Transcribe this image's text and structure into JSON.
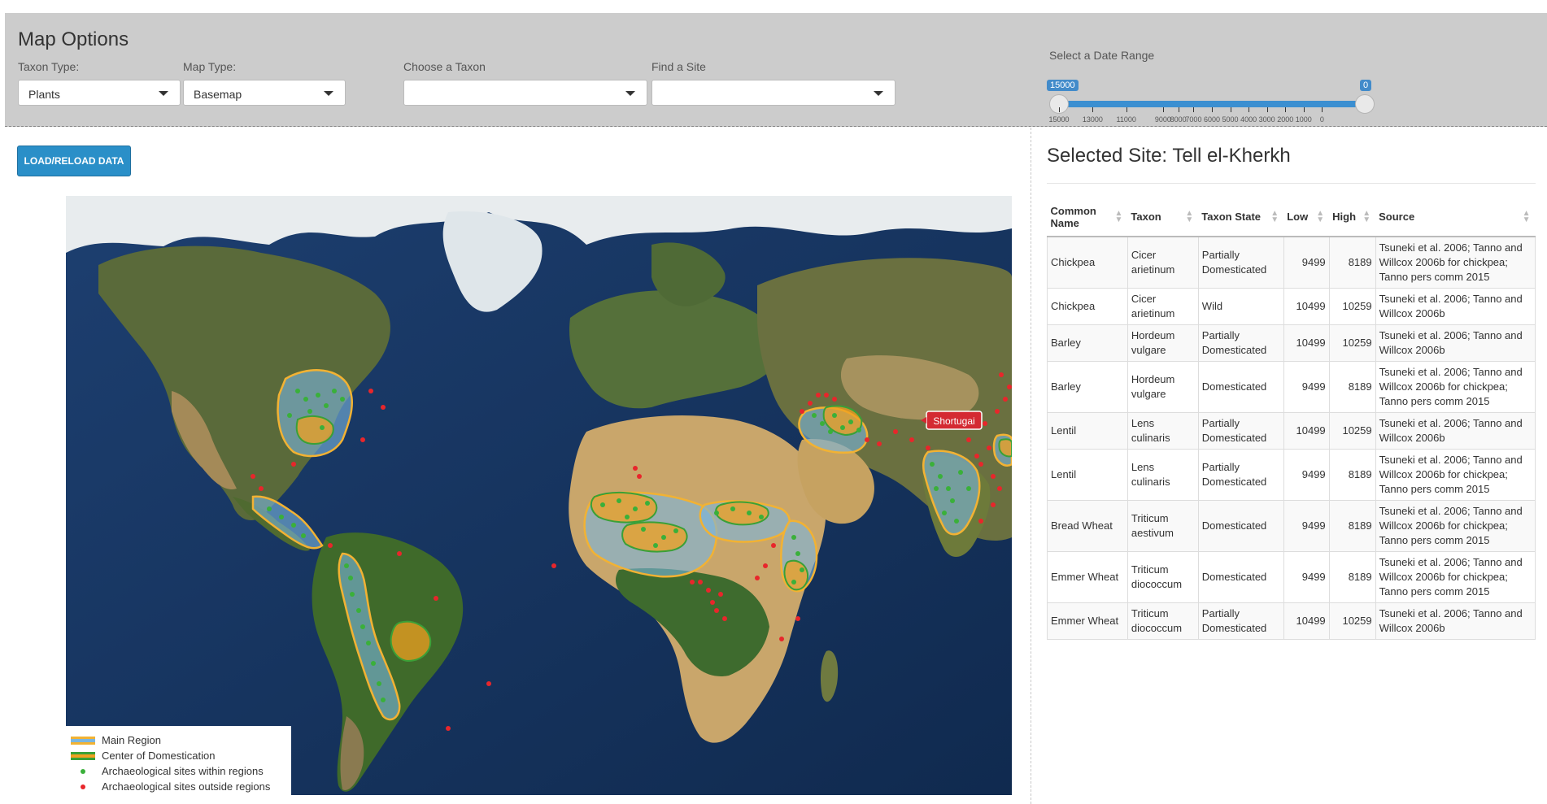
{
  "options": {
    "title": "Map Options",
    "taxon_type": {
      "label": "Taxon Type:",
      "value": "Plants"
    },
    "map_type": {
      "label": "Map Type:",
      "value": "Basemap"
    },
    "choose_taxon": {
      "label": "Choose a Taxon",
      "value": ""
    },
    "find_site": {
      "label": "Find a Site",
      "value": ""
    },
    "date_range": {
      "label": "Select a Date Range",
      "from": "15000",
      "to": "0",
      "ticks": [
        {
          "value": 15000,
          "label": "15000"
        },
        {
          "value": 13000,
          "label": "13000"
        },
        {
          "value": 11000,
          "label": "11000"
        },
        {
          "value": 9000,
          "label": "9000"
        },
        {
          "value": 8000,
          "label": "8000"
        },
        {
          "value": 7000,
          "label": "7000"
        },
        {
          "value": 6000,
          "label": "6000"
        },
        {
          "value": 5000,
          "label": "5000"
        },
        {
          "value": 4000,
          "label": "4000"
        },
        {
          "value": 3000,
          "label": "3000"
        },
        {
          "value": 2000,
          "label": "2000"
        },
        {
          "value": 1000,
          "label": "1000"
        },
        {
          "value": 0,
          "label": "0"
        }
      ]
    }
  },
  "load_button": "LOAD/RELOAD DATA",
  "map": {
    "popup_label": "Shortugai",
    "colors": {
      "main_region": "#7ab6e0",
      "center": "#f0a020",
      "outline": "#f2b233",
      "inner_outline": "#3aa037",
      "site_in": "#3ab03a",
      "site_out": "#e8262b"
    },
    "legend": {
      "main_region": "Main Region",
      "center": "Center of Domestication",
      "sites_within": "Archaeological sites within regions",
      "sites_outside": "Archaeological sites outside regions"
    }
  },
  "site": {
    "title": "Selected Site: Tell el-Kherkh",
    "columns": [
      "Common Name",
      "Taxon",
      "Taxon State",
      "Low",
      "High",
      "Source"
    ],
    "rows": [
      {
        "common": "Chickpea",
        "taxon": "Cicer arietinum",
        "state": "Partially Domesticated",
        "low": "9499",
        "high": "8189",
        "source": "Tsuneki et al. 2006; Tanno and Willcox 2006b for chickpea; Tanno pers comm 2015"
      },
      {
        "common": "Chickpea",
        "taxon": "Cicer arietinum",
        "state": "Wild",
        "low": "10499",
        "high": "10259",
        "source": "Tsuneki et al. 2006; Tanno and Willcox 2006b"
      },
      {
        "common": "Barley",
        "taxon": "Hordeum vulgare",
        "state": "Partially Domesticated",
        "low": "10499",
        "high": "10259",
        "source": "Tsuneki et al. 2006; Tanno and Willcox 2006b"
      },
      {
        "common": "Barley",
        "taxon": "Hordeum vulgare",
        "state": "Domesticated",
        "low": "9499",
        "high": "8189",
        "source": "Tsuneki et al. 2006; Tanno and Willcox 2006b for chickpea; Tanno pers comm 2015"
      },
      {
        "common": "Lentil",
        "taxon": "Lens culinaris",
        "state": "Partially Domesticated",
        "low": "10499",
        "high": "10259",
        "source": "Tsuneki et al. 2006; Tanno and Willcox 2006b"
      },
      {
        "common": "Lentil",
        "taxon": "Lens culinaris",
        "state": "Partially Domesticated",
        "low": "9499",
        "high": "8189",
        "source": "Tsuneki et al. 2006; Tanno and Willcox 2006b for chickpea; Tanno pers comm 2015"
      },
      {
        "common": "Bread Wheat",
        "taxon": "Triticum aestivum",
        "state": "Domesticated",
        "low": "9499",
        "high": "8189",
        "source": "Tsuneki et al. 2006; Tanno and Willcox 2006b for chickpea; Tanno pers comm 2015"
      },
      {
        "common": "Emmer Wheat",
        "taxon": "Triticum diococcum",
        "state": "Domesticated",
        "low": "9499",
        "high": "8189",
        "source": "Tsuneki et al. 2006; Tanno and Willcox 2006b for chickpea; Tanno pers comm 2015"
      },
      {
        "common": "Emmer Wheat",
        "taxon": "Triticum diococcum",
        "state": "Partially Domesticated",
        "low": "10499",
        "high": "10259",
        "source": "Tsuneki et al. 2006; Tanno and Willcox 2006b"
      }
    ]
  }
}
